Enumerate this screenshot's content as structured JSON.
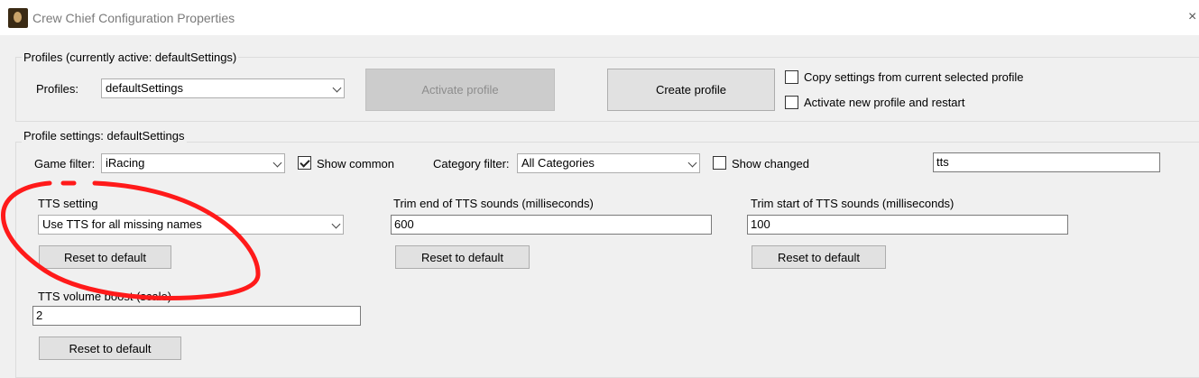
{
  "window": {
    "title": "Crew Chief Configuration Properties",
    "icon": "crew-chief-app-icon",
    "close_glyph": "×"
  },
  "profiles": {
    "group_title": "Profiles (currently active: defaultSettings)",
    "profiles_label": "Profiles:",
    "profiles_selected": "defaultSettings",
    "activate_button": "Activate profile",
    "create_button": "Create profile",
    "copy_settings_label": "Copy settings from current selected profile",
    "copy_settings_checked": false,
    "activate_new_label": "Activate new profile and restart",
    "activate_new_checked": false
  },
  "profile_settings": {
    "group_title": "Profile settings: defaultSettings",
    "game_filter_label": "Game filter:",
    "game_filter_value": "iRacing",
    "show_common_label": "Show common",
    "show_common_checked": true,
    "category_filter_label": "Category filter:",
    "category_filter_value": "All Categories",
    "show_changed_label": "Show changed",
    "show_changed_checked": false,
    "search_value": "tts"
  },
  "settings": {
    "tts_setting": {
      "label": "TTS setting",
      "value": "Use TTS for all missing names",
      "reset": "Reset to default"
    },
    "trim_end": {
      "label": "Trim end of TTS sounds (milliseconds)",
      "value": "600",
      "reset": "Reset to default"
    },
    "trim_start": {
      "label": "Trim start of TTS sounds (milliseconds)",
      "value": "100",
      "reset": "Reset to default"
    },
    "volume_boost": {
      "label": "TTS volume boost (scale)",
      "value": "2",
      "reset": "Reset to default"
    }
  },
  "annotation": {
    "type": "hand-drawn-circle",
    "color": "#ff1a1a"
  }
}
